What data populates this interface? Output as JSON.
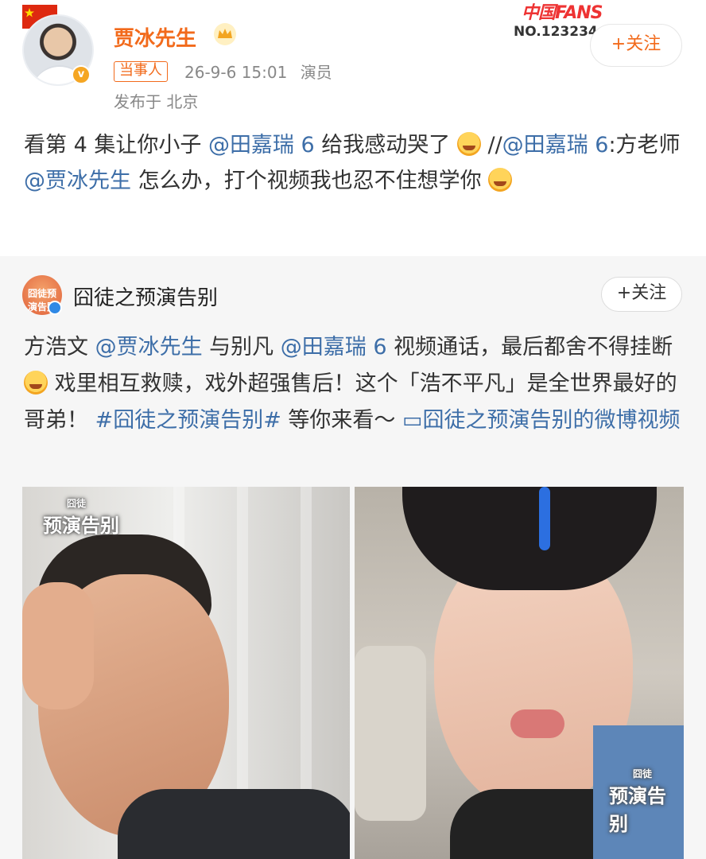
{
  "header": {
    "username": "贾冰先生",
    "badge": "当事人",
    "timestamp": "26-9-6 15:01",
    "role": "演员",
    "location": "发布于 北京",
    "fans_title": "中国FANS",
    "fans_no": "NO.123234",
    "follow_label": "+关注"
  },
  "post": {
    "t1": "看第 4 集让你小子 ",
    "m1": "@田嘉瑞 6",
    "t2": " 给我感动哭了",
    "t3": " //",
    "m2": "@田嘉瑞 6",
    "t4": ":方老师 ",
    "m3": "@贾冰先生",
    "t5": " 怎么办，打个视频我也忍不住想学你"
  },
  "repost": {
    "avatar_text": "囧徒预演告别",
    "name": "囧徒之预演告别",
    "follow_label": "+关注",
    "r1": "方浩文 ",
    "m1": "@贾冰先生",
    "r2": " 与别凡 ",
    "m2": "@田嘉瑞 6",
    "r3": " 视频通话，最后都舍不得挂断",
    "r4": " 戏里相互救赎，戏外超强售后！这个「浩不平凡」是全世界最好的哥弟！ ",
    "tag": "#囧徒之预演告别#",
    "r5": " 等你来看～ ",
    "video_link": "▭囧徒之预演告别的微博视频"
  },
  "video": {
    "wm_left_small": "囧徒",
    "wm_left_big": "预演告别",
    "wm_right_small": "囧徒",
    "wm_right_big": "预演告别"
  },
  "colors": {
    "username": "#f26a1b",
    "link": "#3d6ea8",
    "repost_bg": "#f6f6f6"
  },
  "icons": [
    "china-flag-icon",
    "verified-icon",
    "crown-icon",
    "cry-emoji-icon",
    "hug-emoji-icon",
    "sweat-emoji-icon",
    "video-link-icon"
  ]
}
